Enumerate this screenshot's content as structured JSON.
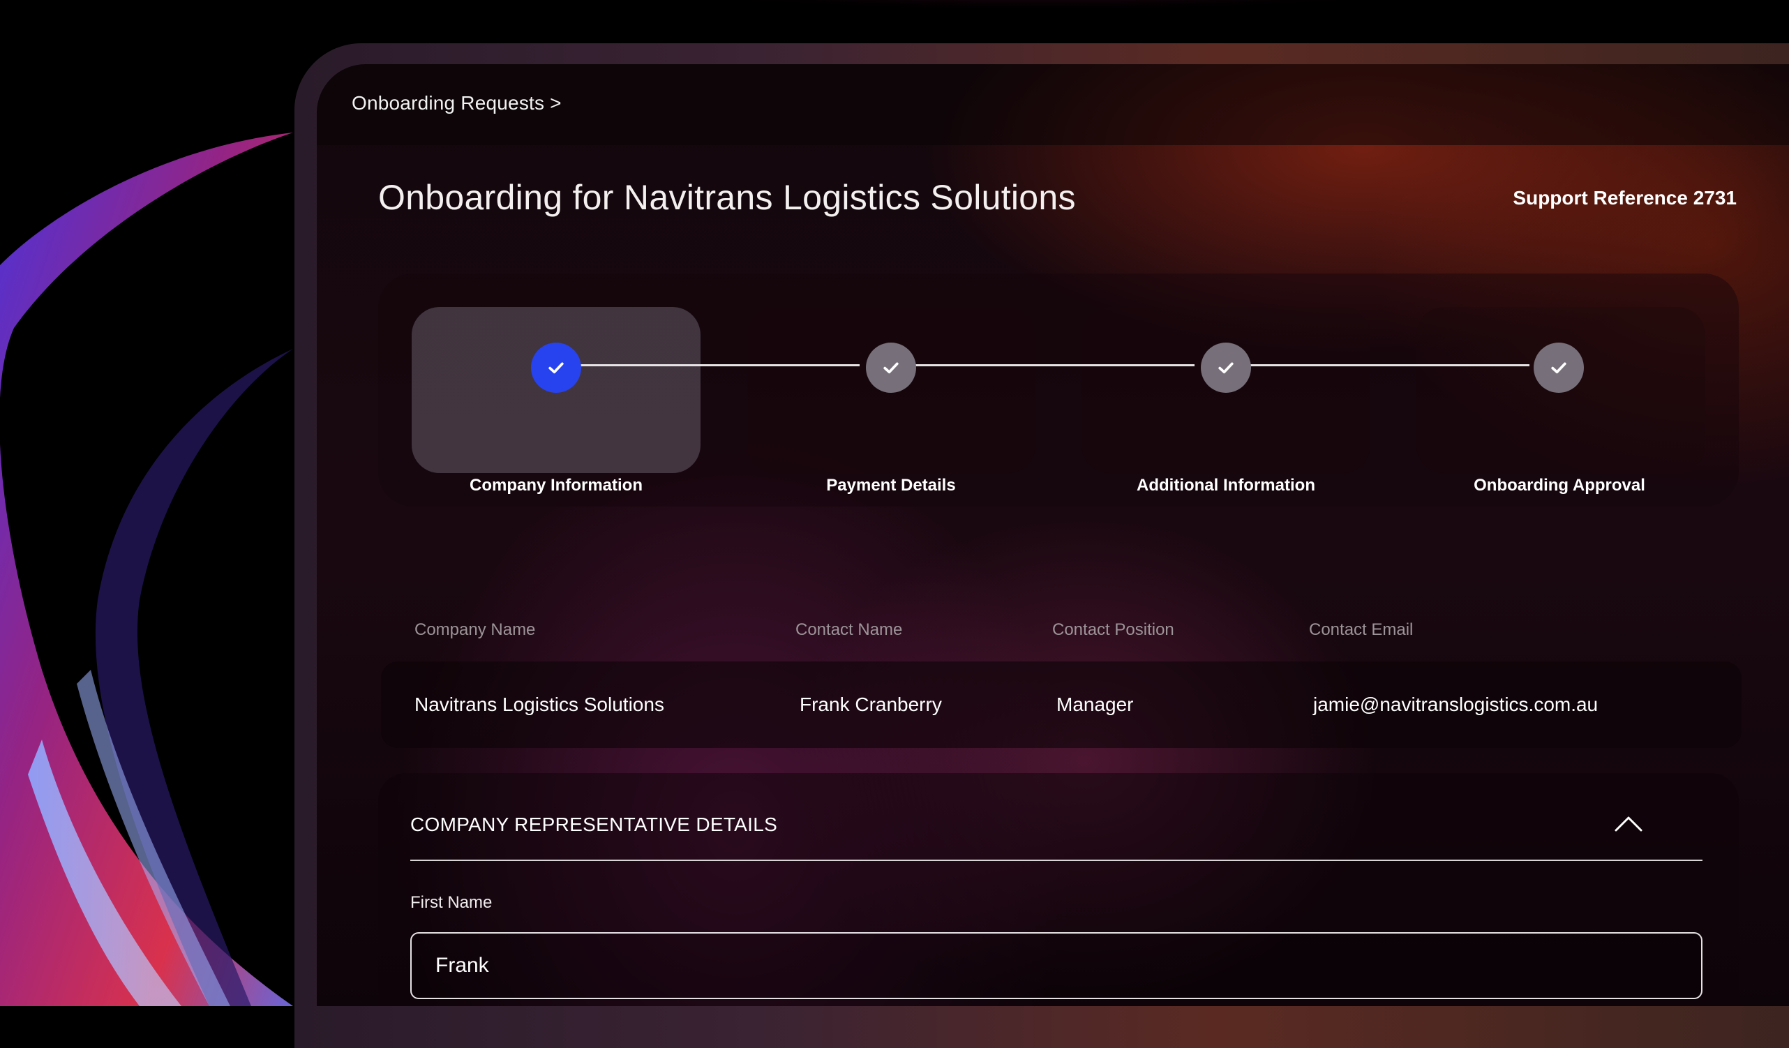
{
  "breadcrumb": {
    "label": "Onboarding Requests >"
  },
  "header": {
    "title": "Onboarding for Navitrans Logistics Solutions",
    "support_reference": "Support Reference 2731"
  },
  "stepper": {
    "steps": [
      {
        "label": "Company Information",
        "state": "active",
        "icon": "check-icon"
      },
      {
        "label": "Payment Details",
        "state": "complete",
        "icon": "check-icon"
      },
      {
        "label": "Additional Information",
        "state": "complete",
        "icon": "check-icon"
      },
      {
        "label": "Onboarding Approval",
        "state": "complete",
        "icon": "check-icon"
      }
    ]
  },
  "summary_table": {
    "columns": [
      "Company Name",
      "Contact Name",
      "Contact Position",
      "Contact Email"
    ],
    "row": [
      "Navitrans Logistics Solutions",
      "Frank Cranberry",
      "Manager",
      "jamie@navitranslogistics.com.au"
    ]
  },
  "representative": {
    "section_title": "COMPANY REPRESENTATIVE DETAILS",
    "toggle_icon": "chevron-up-icon",
    "first_name_label": "First Name",
    "first_name_value": "Frank"
  },
  "colors": {
    "accent_blue": "#2743f0",
    "step_inactive": "#77707a",
    "background": "#000000"
  }
}
